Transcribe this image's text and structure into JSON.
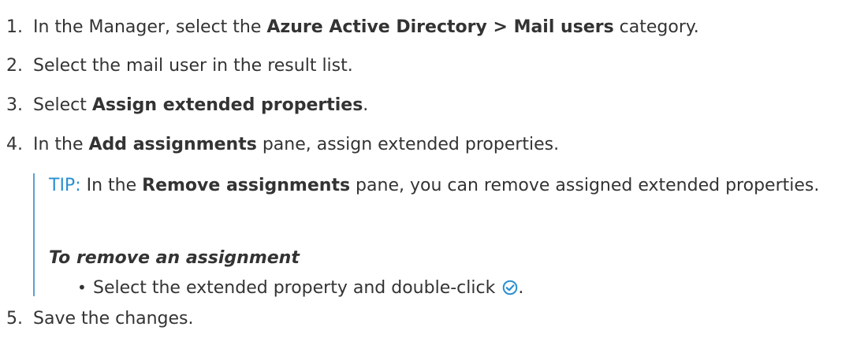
{
  "steps": [
    {
      "num": "1.",
      "pre": "In the Manager, select the ",
      "bold": "Azure Active Directory > Mail users",
      "post": " category."
    },
    {
      "num": "2.",
      "text": "Select the mail user in the result list."
    },
    {
      "num": "3.",
      "pre": "Select ",
      "bold": "Assign extended properties",
      "post": "."
    },
    {
      "num": "4.",
      "pre": "In the ",
      "bold": "Add assignments",
      "post": " pane, assign extended properties."
    },
    {
      "num": "5.",
      "text": "Save the changes."
    }
  ],
  "tip": {
    "label": "TIP:",
    "pre": " In the ",
    "bold": "Remove assignments",
    "post": " pane, you can remove assigned extended properties."
  },
  "procedure": {
    "heading": "To remove an assignment",
    "bullet": "•",
    "bullet_text": "Select the extended property and double-click",
    "bullet_end": ".",
    "icon": "check-circle-icon",
    "icon_color": "#2a8fd1"
  }
}
